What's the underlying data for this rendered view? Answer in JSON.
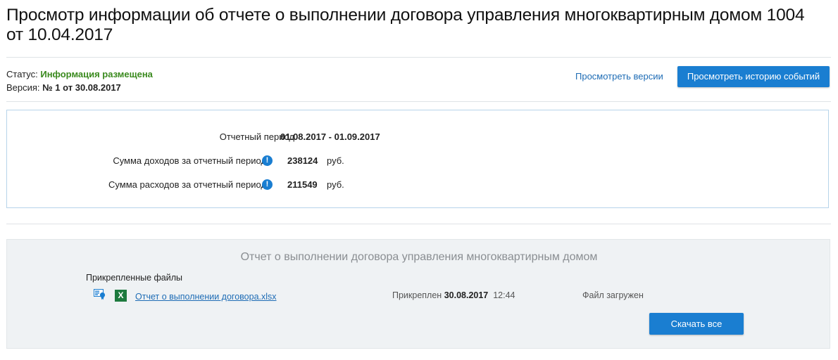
{
  "page": {
    "title": "Просмотр информации об отчете о выполнении договора управления многоквартирным домом 1004 от 10.04.2017"
  },
  "status": {
    "status_label": "Статус:",
    "status_value": "Информация размещена",
    "version_label": "Версия:",
    "version_value": "№ 1 от 30.08.2017"
  },
  "actions": {
    "versions_link": "Просмотреть версии",
    "history_button": "Просмотреть историю событий"
  },
  "report": {
    "rows": [
      {
        "label": "Отчетный период",
        "value": "01.08.2017 - 01.09.2017",
        "unit": ""
      },
      {
        "label": "Сумма доходов за отчетный период",
        "value": "238124",
        "unit": "руб."
      },
      {
        "label": "Сумма расходов за отчетный период",
        "value": "211549",
        "unit": "руб."
      }
    ],
    "info_icon": "!"
  },
  "files_panel": {
    "title": "Отчет о выполнении договора управления многоквартирным домом",
    "attached_files_label": "Прикрепленные файлы",
    "file": {
      "name": "Отчет о выполнении договора.xlsx",
      "type_icon": "X",
      "attached_label": "Прикреплен",
      "attached_date": "30.08.2017",
      "attached_time": "12:44",
      "status": "Файл загружен"
    },
    "download_all_button": "Скачать все"
  },
  "colors": {
    "accent": "#1a7ed1",
    "status_green": "#3a8a1e",
    "excel_green": "#1d7a3e"
  }
}
